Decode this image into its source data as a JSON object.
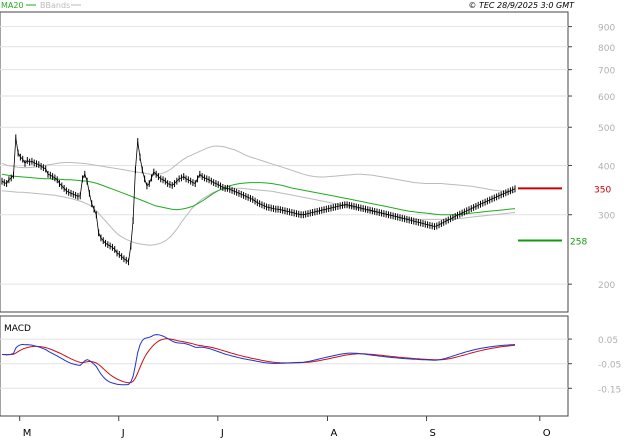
{
  "header": {
    "legend_ma": "MA20",
    "legend_bb": "BBands",
    "credit": "© TEC 28/9/2025 3:0 GMT"
  },
  "colors": {
    "price": "#000000",
    "ma": "#22aa22",
    "bbands": "#bbbbbb",
    "grid": "#e2e2e2",
    "axis": "#444444",
    "tick_label": "#b0b0b0",
    "resistance": "#cc0000",
    "support": "#119911",
    "macd": "#2233cc",
    "signal": "#cc1111"
  },
  "chart_data": [
    {
      "type": "line",
      "panel": "price",
      "yscale": "log",
      "ylim": [
        170,
        980
      ],
      "xlim": [
        0,
        160
      ],
      "ytick_labels": [
        "900",
        "800",
        "700",
        "600",
        "500",
        "400",
        "300",
        "200"
      ],
      "yticks": [
        900,
        800,
        700,
        600,
        500,
        400,
        300,
        200
      ],
      "xtick_labels": [
        "M",
        "J",
        "J",
        "A",
        "S",
        "O"
      ],
      "xticks": [
        5,
        33,
        61,
        92,
        120,
        152
      ],
      "levels": [
        {
          "name": "resistance",
          "label": "350",
          "value": 350
        },
        {
          "name": "support",
          "label": "258",
          "value": 258
        }
      ],
      "series": [
        {
          "name": "MA20",
          "key": "ma",
          "values": [
            380,
            378,
            376,
            375,
            374,
            373,
            372,
            371,
            370,
            370,
            369,
            369,
            368,
            368,
            367,
            366,
            365,
            363,
            360,
            356,
            352,
            348,
            344,
            340,
            336,
            332,
            328,
            324,
            320,
            316,
            314,
            312,
            310,
            309,
            310,
            312,
            315,
            320,
            326,
            333,
            340,
            346,
            351,
            355,
            358,
            360,
            361,
            362,
            362,
            362,
            361,
            360,
            358,
            356,
            353,
            350,
            348,
            346,
            344,
            342,
            340,
            338,
            336,
            334,
            332,
            330,
            328,
            326,
            324,
            322,
            320,
            318,
            316,
            314,
            312,
            310,
            308,
            306,
            305,
            304,
            303,
            302,
            301,
            300,
            300,
            300,
            300,
            301,
            302,
            303,
            304,
            305,
            306,
            307,
            308,
            309,
            310,
            311
          ]
        },
        {
          "name": "BBands",
          "key": "bb_upper",
          "values": [
            405,
            400,
            398,
            396,
            395,
            395,
            396,
            398,
            400,
            402,
            404,
            406,
            407,
            407,
            406,
            405,
            404,
            402,
            400,
            398,
            396,
            394,
            392,
            390,
            388,
            386,
            384,
            382,
            380,
            380,
            381,
            385,
            392,
            402,
            412,
            420,
            426,
            432,
            438,
            444,
            448,
            448,
            446,
            442,
            438,
            432,
            425,
            420,
            416,
            412,
            408,
            404,
            400,
            396,
            392,
            388,
            384,
            380,
            377,
            375,
            374,
            374,
            375,
            376,
            377,
            378,
            379,
            380,
            380,
            379,
            378,
            376,
            374,
            372,
            370,
            368,
            366,
            364,
            362,
            361,
            360,
            360,
            360,
            360,
            359,
            358,
            357,
            356,
            355,
            354,
            352,
            350,
            348,
            346,
            345,
            344,
            343,
            342
          ]
        },
        {
          "name": "BBands lower",
          "key": "bb_lower",
          "values": [
            345,
            344,
            343,
            342,
            342,
            341,
            340,
            339,
            338,
            337,
            336,
            334,
            332,
            330,
            327,
            324,
            320,
            315,
            305,
            295,
            285,
            275,
            267,
            262,
            258,
            255,
            253,
            252,
            251,
            252,
            254,
            258,
            265,
            275,
            288,
            300,
            312,
            322,
            330,
            336,
            342,
            346,
            348,
            349,
            350,
            350,
            349,
            348,
            347,
            346,
            345,
            344,
            342,
            340,
            338,
            336,
            334,
            332,
            330,
            328,
            326,
            324,
            322,
            320,
            318,
            316,
            314,
            312,
            310,
            308,
            306,
            304,
            302,
            300,
            298,
            296,
            294,
            293,
            292,
            292,
            292,
            292,
            292,
            292,
            292,
            292,
            293,
            294,
            295,
            296,
            297,
            298,
            299,
            300,
            301,
            302,
            303,
            304
          ]
        },
        {
          "name": "Price",
          "key": "price",
          "values": [
            365,
            362,
            360,
            368,
            372,
            378,
            470,
            430,
            420,
            415,
            405,
            412,
            408,
            410,
            406,
            404,
            402,
            398,
            395,
            392,
            380,
            378,
            375,
            372,
            368,
            360,
            355,
            350,
            345,
            342,
            340,
            338,
            336,
            334,
            335,
            370,
            380,
            365,
            340,
            320,
            310,
            300,
            270,
            262,
            258,
            254,
            252,
            250,
            248,
            245,
            240,
            238,
            235,
            232,
            230,
            228,
            250,
            290,
            390,
            460,
            420,
            390,
            370,
            355,
            360,
            372,
            385,
            380,
            375,
            370,
            368,
            365,
            360,
            358,
            356,
            360,
            365,
            370,
            372,
            375,
            370,
            368,
            365,
            362,
            360,
            370,
            380,
            375,
            372,
            370,
            368,
            365,
            362,
            360,
            358,
            355,
            352,
            350
          ]
        },
        {
          "name": "Price extended",
          "key": "price2",
          "values": [
            350,
            348,
            346,
            344,
            342,
            340,
            338,
            336,
            334,
            332,
            330,
            328,
            325,
            322,
            320,
            318,
            316,
            314,
            313,
            312,
            311,
            310,
            310,
            309,
            308,
            307,
            306,
            305,
            304,
            303,
            302,
            301,
            300,
            300,
            301,
            302,
            303,
            304,
            305,
            306,
            307,
            308,
            309,
            310,
            311,
            312,
            313,
            314,
            315,
            316,
            317,
            318,
            318,
            317,
            316,
            315,
            314,
            313,
            312,
            311,
            310,
            309,
            308,
            307,
            306,
            305,
            304,
            303,
            302,
            301,
            300,
            299,
            298,
            297,
            296,
            295,
            294,
            293,
            292,
            291,
            290,
            289,
            288,
            287,
            286,
            285,
            284,
            283,
            282,
            281,
            280,
            281,
            283,
            285,
            287,
            289,
            291,
            293,
            295,
            297,
            299,
            301,
            303,
            305,
            307,
            309,
            311,
            313,
            315,
            317,
            319,
            321,
            323,
            325,
            327,
            329,
            331,
            333,
            335,
            337,
            339,
            341,
            343,
            345,
            347,
            349
          ]
        }
      ]
    },
    {
      "type": "line",
      "panel": "macd",
      "title": "MACD",
      "ylim": [
        -0.04,
        0.025
      ],
      "ytick_labels": [
        "0.05",
        "-0.05",
        "-0.15"
      ],
      "yticks": [
        0.01,
        -0.006,
        -0.022
      ],
      "series": [
        {
          "name": "MACD",
          "key": "macd"
        },
        {
          "name": "Signal",
          "key": "signal"
        }
      ]
    }
  ]
}
